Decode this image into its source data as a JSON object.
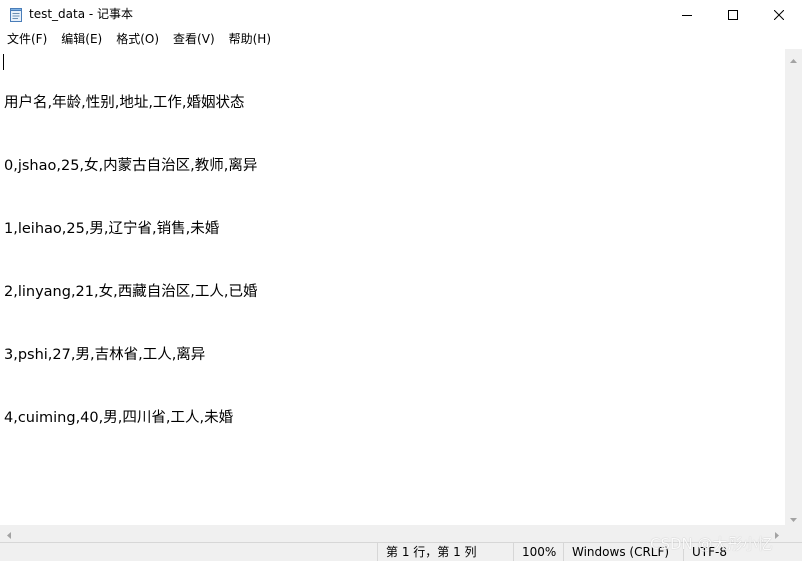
{
  "window": {
    "title": "test_data - 记事本",
    "icon": "notepad-icon",
    "controls": {
      "minimize": "minimize-icon",
      "maximize": "maximize-icon",
      "close": "close-icon"
    }
  },
  "menu": {
    "items": [
      {
        "label": "文件(F)"
      },
      {
        "label": "编辑(E)"
      },
      {
        "label": "格式(O)"
      },
      {
        "label": "查看(V)"
      },
      {
        "label": "帮助(H)"
      }
    ]
  },
  "editor": {
    "lines": [
      "用户名,年龄,性别,地址,工作,婚姻状态",
      "0,jshao,25,女,内蒙古自治区,教师,离异",
      "1,leihao,25,男,辽宁省,销售,未婚",
      "2,linyang,21,女,西藏自治区,工人,已婚",
      "3,pshi,27,男,吉林省,工人,离异",
      "4,cuiming,40,男,四川省,工人,未婚"
    ]
  },
  "status": {
    "position": "第 1 行，第 1 列",
    "zoom": "100%",
    "line_ending": "Windows (CRLF)",
    "encoding": "UTF-8"
  },
  "watermark": "CSDN @大彤小忆"
}
